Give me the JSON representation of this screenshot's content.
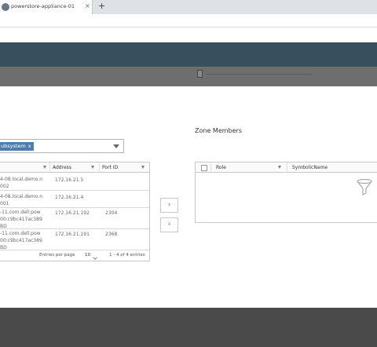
{
  "browser": {
    "tab_title": "powerstore-appliance-01",
    "tab_close": "×",
    "new_tab": "+"
  },
  "selector": {
    "chip_label": "ubsystem",
    "chip_remove": "x"
  },
  "left_grid": {
    "headers": [
      "Address",
      "Port ID"
    ],
    "rows": [
      {
        "name": [
          "4-08.local.demo.n",
          "002"
        ],
        "address": "172.16.21.5",
        "port_id": ""
      },
      {
        "name": [
          "4-08.local.demo.n",
          "001"
        ],
        "address": "172.16.21.4",
        "port_id": ""
      },
      {
        "name": [
          "-11.com.dell.pow",
          "00:c9bc417ac389",
          "BD"
        ],
        "address": "172.16.21.192",
        "port_id": "2304"
      },
      {
        "name": [
          "-11.com.dell.pow",
          "00:c9bc417ac389",
          "BD"
        ],
        "address": "172.16.21.191",
        "port_id": "2368"
      }
    ],
    "footer": {
      "entries_per_page_label": "Entries per page",
      "entries_per_page_value": "10",
      "range": "1 - 4 of 4 entries"
    }
  },
  "transfer": {
    "add": "›",
    "remove": "‹"
  },
  "zone_members": {
    "title": "Zone Members",
    "headers": [
      "Role",
      "SymbolicName"
    ]
  },
  "colors": {
    "header": "#38505e",
    "chip": "#4d7fae"
  }
}
